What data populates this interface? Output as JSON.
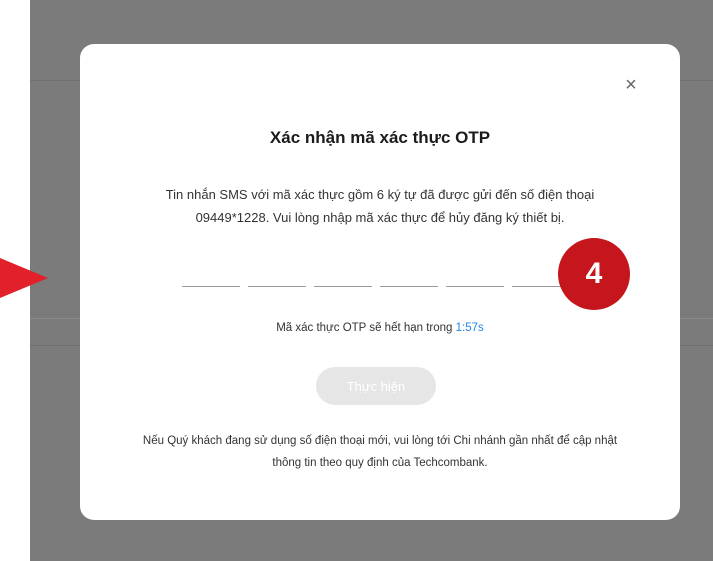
{
  "modal": {
    "title": "Xác nhận mã xác thực OTP",
    "description_line1": "Tin nhắn SMS với mã xác thực gồm 6 ký tự đã được gửi đến số điện thoại",
    "description_line2": "09449*1228. Vui lòng nhập mã xác thực để hủy đăng ký thiết bị.",
    "close_label": "×",
    "otp_inputs": [
      "",
      "",
      "",
      "",
      "",
      ""
    ],
    "expiry_text": "Mã xác thực OTP sẽ hết hạn trong",
    "expiry_time": "1:57s",
    "submit_label": "Thực hiện",
    "note_line1": "Nếu Quý khách đang sử dụng số điện thoại mới, vui lòng tới Chi nhánh gần nhất để cập nhật",
    "note_line2": "thông tin theo quy định của Techcombank."
  },
  "annotation": {
    "step_number": "4",
    "badge_color": "#c4161c",
    "pointer_color": "#e2202a"
  },
  "colors": {
    "overlay": "#7b7b7b",
    "link": "#1e88e5",
    "button_disabled": "#e6e6e6"
  }
}
